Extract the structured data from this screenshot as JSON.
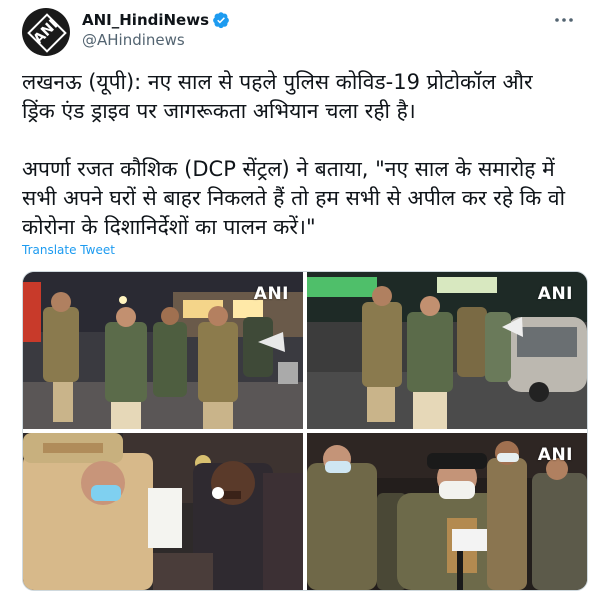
{
  "account": {
    "display_name": "ANI_HindiNews",
    "handle": "@AHindinews",
    "avatar_text": "ANI"
  },
  "tweet": {
    "text": "लखनऊ (यूपी): नए साल से पहले पुलिस कोविड-19 प्रोटोकॉल और ड्रिंक एंड ड्राइव पर जागरूकता अभियान चला रही है।\n\nअपर्णा रजत कौशिक (DCP सेंट्रल) ने बताया, \"नए साल के समारोह में सभी अपने घरों से बाहर निकलते हैं तो हम सभी से अपील कर रहे कि वो कोरोना के दिशानिर्देशों का पालन करें।\"",
    "translate_label": "Translate Tweet"
  },
  "media": {
    "watermark": "ANI",
    "mic_label": "ANI"
  },
  "colors": {
    "link": "#1d9bf0",
    "verified": "#1d9bf0",
    "secondary_text": "#536471"
  },
  "icons": {
    "verified": "verified-badge-icon",
    "more": "more-options-icon"
  }
}
